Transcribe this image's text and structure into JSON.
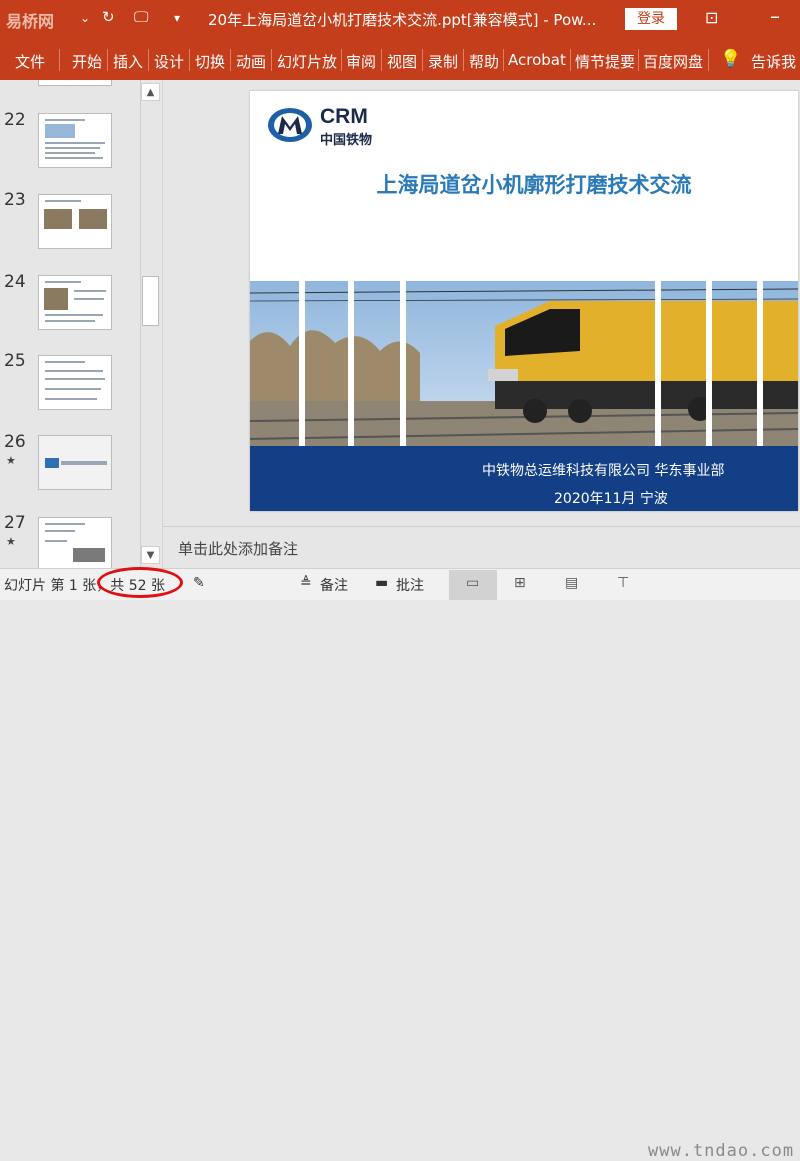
{
  "titlebar": {
    "watermark": "易桥网",
    "title": "20年上海局道岔小机打磨技术交流.ppt[兼容模式] - Pow...",
    "login": "登录"
  },
  "ribbon": {
    "tabs": [
      "文件",
      "开始",
      "插入",
      "设计",
      "切换",
      "动画",
      "幻灯片放",
      "审阅",
      "视图",
      "录制",
      "帮助",
      "Acrobat",
      "情节提要",
      "百度网盘",
      "告诉我"
    ]
  },
  "thumbnails": [
    {
      "num": "22",
      "star": ""
    },
    {
      "num": "23",
      "star": ""
    },
    {
      "num": "24",
      "star": ""
    },
    {
      "num": "25",
      "star": ""
    },
    {
      "num": "26",
      "star": "★"
    },
    {
      "num": "27",
      "star": "★"
    }
  ],
  "slide": {
    "logo_text": "CRM",
    "logo_sub": "中国铁物",
    "title": "上海局道岔小机廓形打磨技术交流",
    "footer_line1": "中铁物总运维科技有限公司 华东事业部",
    "footer_line2": "2020年11月  宁波"
  },
  "notes": {
    "placeholder": "单击此处添加备注"
  },
  "status": {
    "slide_info": "幻灯片 第 1 张，共 52 张",
    "notes_label": "备注",
    "comments_label": "批注"
  },
  "site_watermark": "www.tndao.com",
  "colors": {
    "accent": "#c43e1c",
    "slide_title": "#2a7ab8",
    "footer_band": "#123f86",
    "highlight": "#e01010"
  },
  "icons": [
    "undo-icon",
    "present-icon",
    "customize-icon",
    "restore-icon",
    "lightbulb-icon",
    "accessibility-icon",
    "notes-icon",
    "comments-icon",
    "normal-view-icon",
    "sorter-view-icon",
    "reading-view-icon",
    "slideshow-icon"
  ]
}
